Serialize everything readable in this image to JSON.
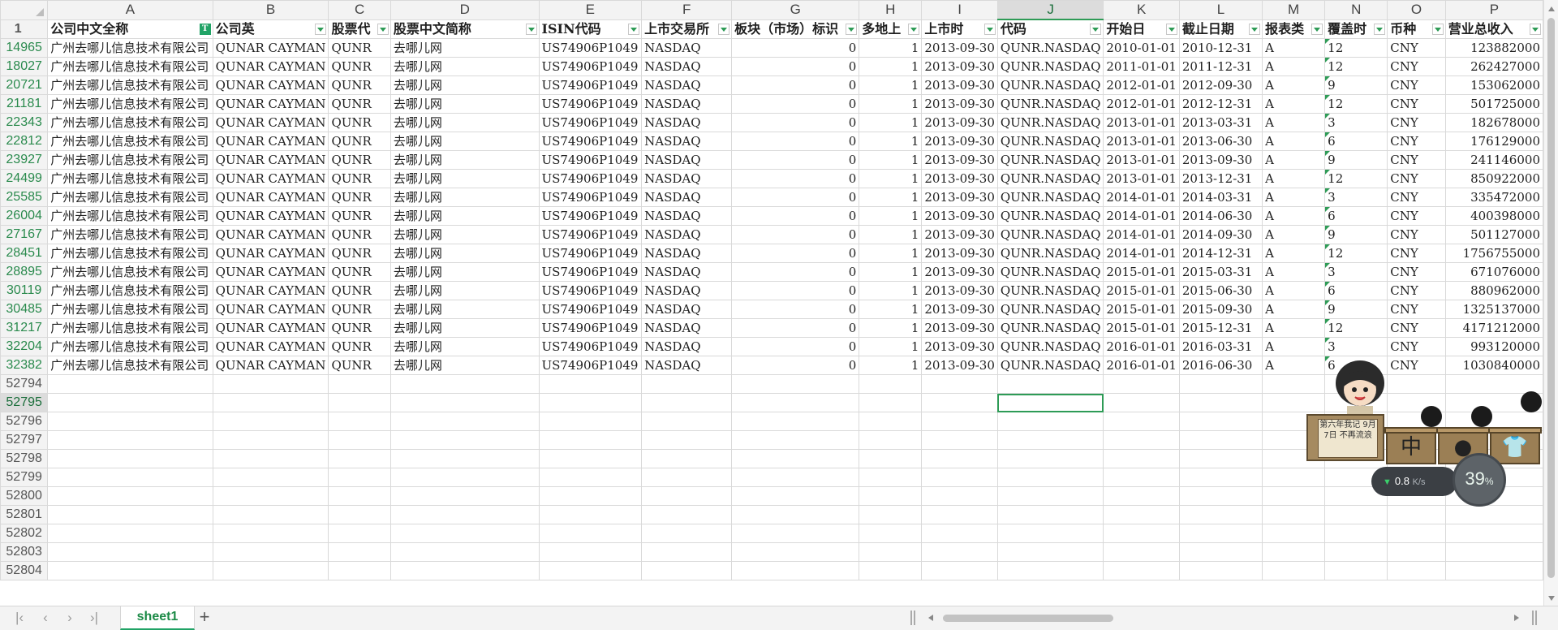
{
  "columns": [
    "A",
    "B",
    "C",
    "D",
    "E",
    "F",
    "G",
    "H",
    "I",
    "J",
    "K",
    "L",
    "M",
    "N",
    "O",
    "P"
  ],
  "active_column": "J",
  "header_row_number": "1",
  "headers": [
    "公司中文全称",
    "公司英",
    "股票代",
    "股票中文简称",
    "ISIN代码",
    "上市交易所",
    "板块（市场）标识",
    "多地上",
    "上市时",
    "代码",
    "开始日",
    "截止日期",
    "报表类",
    "覆盖时",
    "币种",
    "营业总收入"
  ],
  "rows": [
    {
      "n": "14965",
      "c": [
        "广州去哪儿信息技术有限公司",
        "QUNAR CAYMAN",
        "QUNR",
        "去哪儿网",
        "US74906P1049",
        "NASDAQ",
        "0",
        "1",
        "2013-09-30",
        "QUNR.NASDAQ",
        "2010-01-01",
        "2010-12-31",
        "A",
        "12",
        "CNY",
        "123882000"
      ]
    },
    {
      "n": "18027",
      "c": [
        "广州去哪儿信息技术有限公司",
        "QUNAR CAYMAN",
        "QUNR",
        "去哪儿网",
        "US74906P1049",
        "NASDAQ",
        "0",
        "1",
        "2013-09-30",
        "QUNR.NASDAQ",
        "2011-01-01",
        "2011-12-31",
        "A",
        "12",
        "CNY",
        "262427000"
      ]
    },
    {
      "n": "20721",
      "c": [
        "广州去哪儿信息技术有限公司",
        "QUNAR CAYMAN",
        "QUNR",
        "去哪儿网",
        "US74906P1049",
        "NASDAQ",
        "0",
        "1",
        "2013-09-30",
        "QUNR.NASDAQ",
        "2012-01-01",
        "2012-09-30",
        "A",
        "9",
        "CNY",
        "153062000"
      ]
    },
    {
      "n": "21181",
      "c": [
        "广州去哪儿信息技术有限公司",
        "QUNAR CAYMAN",
        "QUNR",
        "去哪儿网",
        "US74906P1049",
        "NASDAQ",
        "0",
        "1",
        "2013-09-30",
        "QUNR.NASDAQ",
        "2012-01-01",
        "2012-12-31",
        "A",
        "12",
        "CNY",
        "501725000"
      ]
    },
    {
      "n": "22343",
      "c": [
        "广州去哪儿信息技术有限公司",
        "QUNAR CAYMAN",
        "QUNR",
        "去哪儿网",
        "US74906P1049",
        "NASDAQ",
        "0",
        "1",
        "2013-09-30",
        "QUNR.NASDAQ",
        "2013-01-01",
        "2013-03-31",
        "A",
        "3",
        "CNY",
        "182678000"
      ]
    },
    {
      "n": "22812",
      "c": [
        "广州去哪儿信息技术有限公司",
        "QUNAR CAYMAN",
        "QUNR",
        "去哪儿网",
        "US74906P1049",
        "NASDAQ",
        "0",
        "1",
        "2013-09-30",
        "QUNR.NASDAQ",
        "2013-01-01",
        "2013-06-30",
        "A",
        "6",
        "CNY",
        "176129000"
      ]
    },
    {
      "n": "23927",
      "c": [
        "广州去哪儿信息技术有限公司",
        "QUNAR CAYMAN",
        "QUNR",
        "去哪儿网",
        "US74906P1049",
        "NASDAQ",
        "0",
        "1",
        "2013-09-30",
        "QUNR.NASDAQ",
        "2013-01-01",
        "2013-09-30",
        "A",
        "9",
        "CNY",
        "241146000"
      ]
    },
    {
      "n": "24499",
      "c": [
        "广州去哪儿信息技术有限公司",
        "QUNAR CAYMAN",
        "QUNR",
        "去哪儿网",
        "US74906P1049",
        "NASDAQ",
        "0",
        "1",
        "2013-09-30",
        "QUNR.NASDAQ",
        "2013-01-01",
        "2013-12-31",
        "A",
        "12",
        "CNY",
        "850922000"
      ]
    },
    {
      "n": "25585",
      "c": [
        "广州去哪儿信息技术有限公司",
        "QUNAR CAYMAN",
        "QUNR",
        "去哪儿网",
        "US74906P1049",
        "NASDAQ",
        "0",
        "1",
        "2013-09-30",
        "QUNR.NASDAQ",
        "2014-01-01",
        "2014-03-31",
        "A",
        "3",
        "CNY",
        "335472000"
      ]
    },
    {
      "n": "26004",
      "c": [
        "广州去哪儿信息技术有限公司",
        "QUNAR CAYMAN",
        "QUNR",
        "去哪儿网",
        "US74906P1049",
        "NASDAQ",
        "0",
        "1",
        "2013-09-30",
        "QUNR.NASDAQ",
        "2014-01-01",
        "2014-06-30",
        "A",
        "6",
        "CNY",
        "400398000"
      ]
    },
    {
      "n": "27167",
      "c": [
        "广州去哪儿信息技术有限公司",
        "QUNAR CAYMAN",
        "QUNR",
        "去哪儿网",
        "US74906P1049",
        "NASDAQ",
        "0",
        "1",
        "2013-09-30",
        "QUNR.NASDAQ",
        "2014-01-01",
        "2014-09-30",
        "A",
        "9",
        "CNY",
        "501127000"
      ]
    },
    {
      "n": "28451",
      "c": [
        "广州去哪儿信息技术有限公司",
        "QUNAR CAYMAN",
        "QUNR",
        "去哪儿网",
        "US74906P1049",
        "NASDAQ",
        "0",
        "1",
        "2013-09-30",
        "QUNR.NASDAQ",
        "2014-01-01",
        "2014-12-31",
        "A",
        "12",
        "CNY",
        "1756755000"
      ]
    },
    {
      "n": "28895",
      "c": [
        "广州去哪儿信息技术有限公司",
        "QUNAR CAYMAN",
        "QUNR",
        "去哪儿网",
        "US74906P1049",
        "NASDAQ",
        "0",
        "1",
        "2013-09-30",
        "QUNR.NASDAQ",
        "2015-01-01",
        "2015-03-31",
        "A",
        "3",
        "CNY",
        "671076000"
      ]
    },
    {
      "n": "30119",
      "c": [
        "广州去哪儿信息技术有限公司",
        "QUNAR CAYMAN",
        "QUNR",
        "去哪儿网",
        "US74906P1049",
        "NASDAQ",
        "0",
        "1",
        "2013-09-30",
        "QUNR.NASDAQ",
        "2015-01-01",
        "2015-06-30",
        "A",
        "6",
        "CNY",
        "880962000"
      ]
    },
    {
      "n": "30485",
      "c": [
        "广州去哪儿信息技术有限公司",
        "QUNAR CAYMAN",
        "QUNR",
        "去哪儿网",
        "US74906P1049",
        "NASDAQ",
        "0",
        "1",
        "2013-09-30",
        "QUNR.NASDAQ",
        "2015-01-01",
        "2015-09-30",
        "A",
        "9",
        "CNY",
        "1325137000"
      ]
    },
    {
      "n": "31217",
      "c": [
        "广州去哪儿信息技术有限公司",
        "QUNAR CAYMAN",
        "QUNR",
        "去哪儿网",
        "US74906P1049",
        "NASDAQ",
        "0",
        "1",
        "2013-09-30",
        "QUNR.NASDAQ",
        "2015-01-01",
        "2015-12-31",
        "A",
        "12",
        "CNY",
        "4171212000"
      ]
    },
    {
      "n": "32204",
      "c": [
        "广州去哪儿信息技术有限公司",
        "QUNAR CAYMAN",
        "QUNR",
        "去哪儿网",
        "US74906P1049",
        "NASDAQ",
        "0",
        "1",
        "2013-09-30",
        "QUNR.NASDAQ",
        "2016-01-01",
        "2016-03-31",
        "A",
        "3",
        "CNY",
        "993120000"
      ]
    },
    {
      "n": "32382",
      "c": [
        "广州去哪儿信息技术有限公司",
        "QUNAR CAYMAN",
        "QUNR",
        "去哪儿网",
        "US74906P1049",
        "NASDAQ",
        "0",
        "1",
        "2013-09-30",
        "QUNR.NASDAQ",
        "2016-01-01",
        "2016-06-30",
        "A",
        "6",
        "CNY",
        "1030840000"
      ]
    }
  ],
  "empty_rows": [
    "52794",
    "52795",
    "52796",
    "52797",
    "52798",
    "52799",
    "52800",
    "52801",
    "52802",
    "52803",
    "52804"
  ],
  "current_row": "52795",
  "sheet_tab": "sheet1",
  "nav_icons": [
    "first-sheet-icon",
    "prev-sheet-icon",
    "next-sheet-icon",
    "last-sheet-icon"
  ],
  "widget": {
    "sign_text": "第六年我记 9月7日 不再流浪",
    "box_glyphs": [
      "中",
      "●",
      "👕"
    ],
    "net_speed": "0.8",
    "net_unit": "K/s",
    "cpu_percent": "39",
    "cpu_unit": "%"
  },
  "colors": {
    "accent": "#21a366",
    "row_number_filtered": "#2a8a4d",
    "grid": "#d9d9d9"
  }
}
